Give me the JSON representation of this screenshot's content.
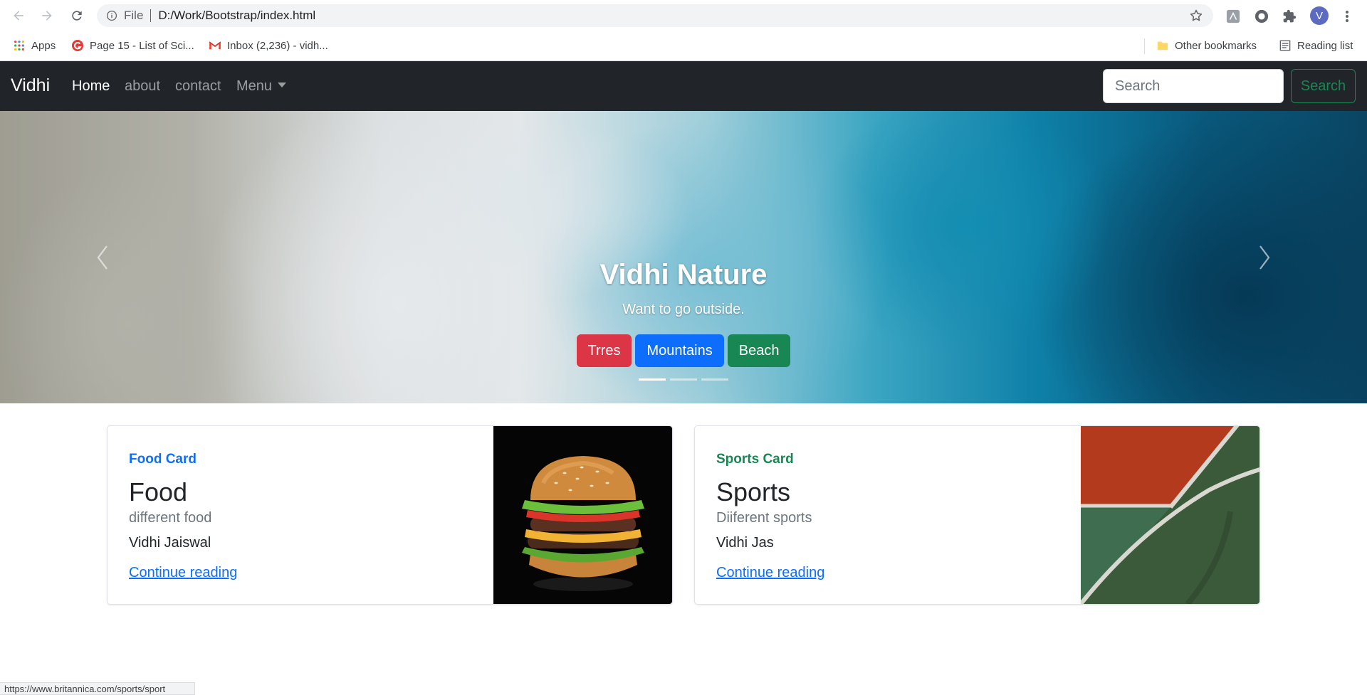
{
  "browser": {
    "url_scheme": "File",
    "url": "D:/Work/Bootstrap/index.html",
    "avatar_letter": "V",
    "bookmarks": [
      {
        "label": "Apps",
        "icon": "apps-grid-icon"
      },
      {
        "label": "Page 15 - List of Sci...",
        "icon": "site-favicon-icon"
      },
      {
        "label": "Inbox (2,236) - vidh...",
        "icon": "gmail-icon"
      }
    ],
    "other_bookmarks": "Other bookmarks",
    "reading_list": "Reading list",
    "status_url": "https://www.britannica.com/sports/sport"
  },
  "navbar": {
    "brand": "Vidhi",
    "links": [
      "Home",
      "about",
      "contact",
      "Menu"
    ],
    "search_placeholder": "Search",
    "search_button": "Search"
  },
  "carousel": {
    "title": "Vidhi Nature",
    "subtitle": "Want to go outside.",
    "buttons": [
      "Trres",
      "Mountains",
      "Beach"
    ],
    "active_slide": 1,
    "slide_count": 3
  },
  "cards": [
    {
      "category": "Food Card",
      "title": "Food",
      "subtitle": "different food",
      "author": "Vidhi Jaiswal",
      "link": "Continue reading",
      "accent": "#0d6efd"
    },
    {
      "category": "Sports Card",
      "title": "Sports",
      "subtitle": "Diiferent sports",
      "author": "Vidhi Jas",
      "link": "Continue reading",
      "accent": "#198754"
    }
  ],
  "colors": {
    "navbar_bg": "#212529",
    "success": "#198754",
    "primary": "#0d6efd",
    "danger": "#dc3545"
  }
}
